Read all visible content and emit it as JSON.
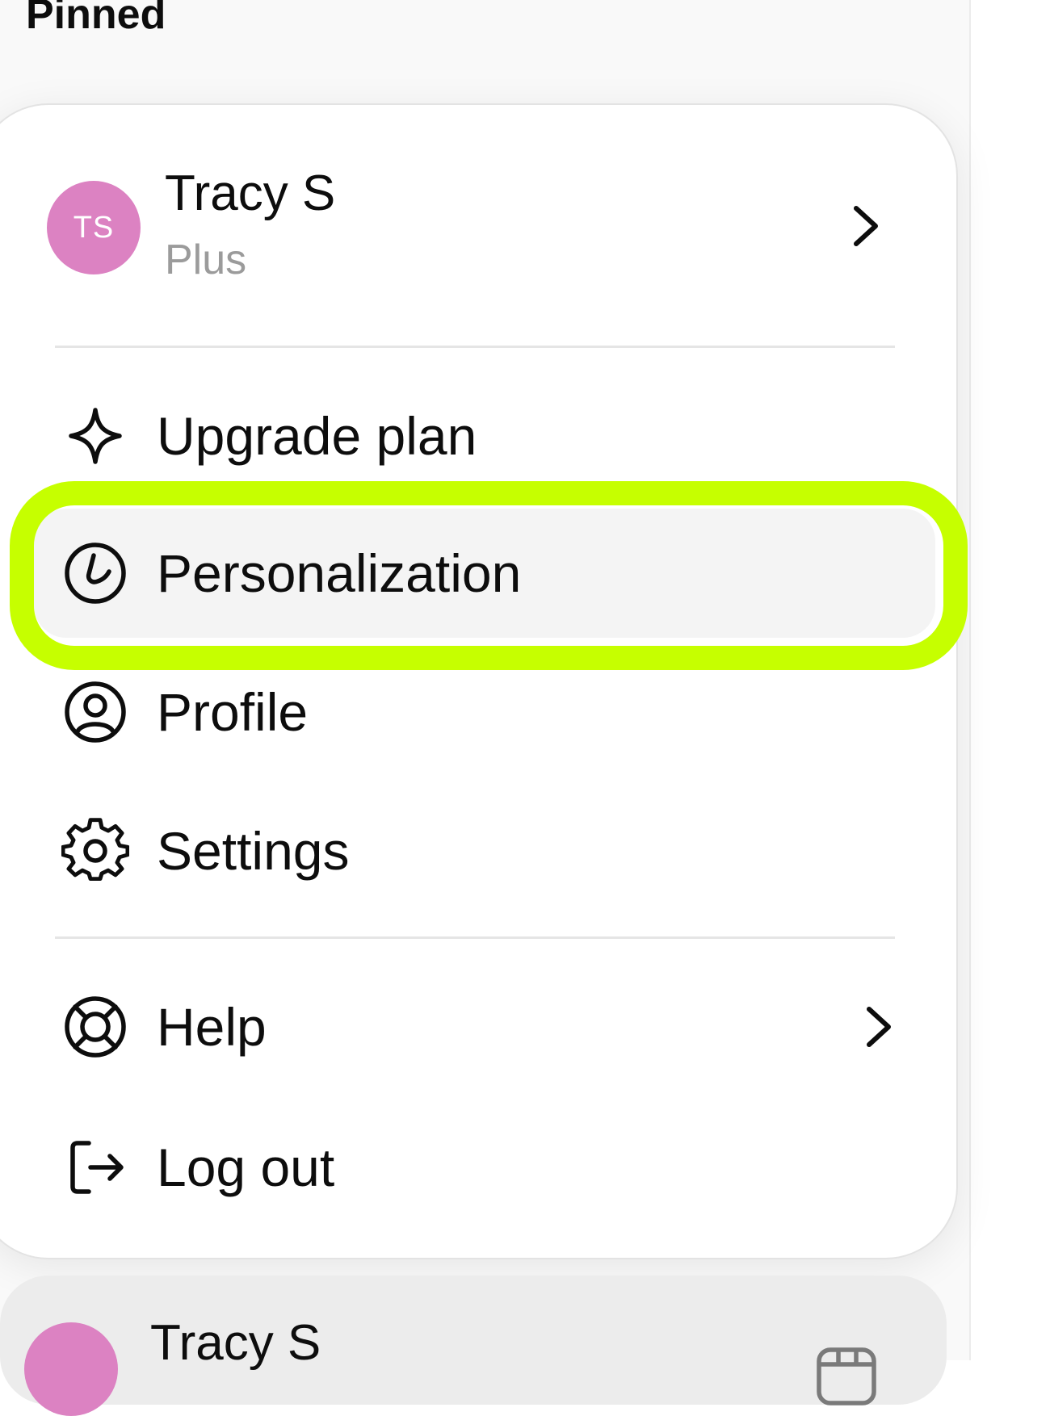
{
  "colors": {
    "avatar": "#dc82c2",
    "highlight": "#c6ff00",
    "hover": "#f4f4f4",
    "text": "#0d0d0d",
    "muted": "#9b9b9b"
  },
  "sidebar": {
    "section_title": "Pinned"
  },
  "account_menu": {
    "user": {
      "initials": "TS",
      "name": "Tracy S",
      "plan": "Plus",
      "icon": "chevron-right-icon"
    },
    "items": [
      {
        "label": "Upgrade plan",
        "icon": "sparkle-icon"
      },
      {
        "label": "Personalization",
        "icon": "personalization-icon",
        "highlighted": true
      },
      {
        "label": "Profile",
        "icon": "profile-icon"
      },
      {
        "label": "Settings",
        "icon": "gear-icon"
      },
      {
        "label": "Help",
        "icon": "lifebuoy-icon",
        "has_submenu": true
      },
      {
        "label": "Log out",
        "icon": "logout-icon"
      }
    ]
  },
  "bottom_account": {
    "name": "Tracy S",
    "icon": "panel-icon"
  }
}
